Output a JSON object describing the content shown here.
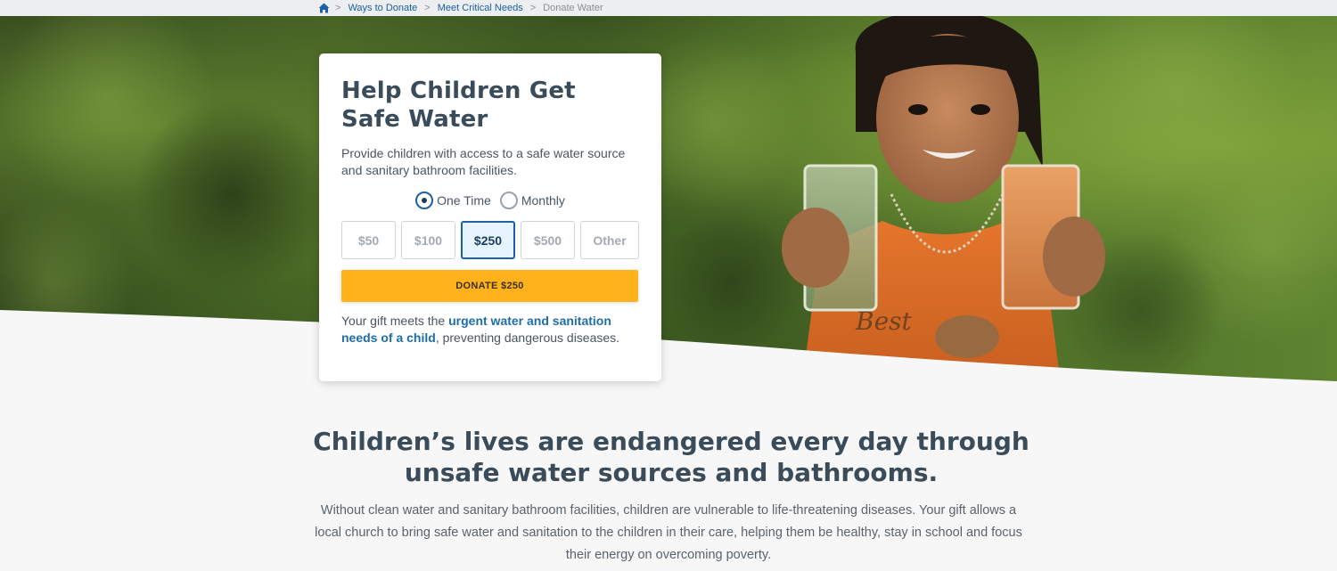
{
  "breadcrumb": {
    "home_icon": "home-icon",
    "separator": ">",
    "items": [
      "Ways to Donate",
      "Meet Critical Needs"
    ],
    "current": "Donate Water"
  },
  "card": {
    "title": "Help Children Get Safe Water",
    "description": "Provide children with access to a safe water source and sanitary bathroom facilities.",
    "frequency": {
      "options": [
        "One Time",
        "Monthly"
      ],
      "selected": "One Time"
    },
    "amounts": [
      "$50",
      "$100",
      "$250",
      "$500",
      "Other"
    ],
    "selected_amount": "$250",
    "donate_label": "DONATE $250",
    "gift_text_prefix": "Your gift meets the ",
    "gift_text_link": "urgent water and sanitation needs of a child",
    "gift_text_suffix": ", preventing dangerous diseases."
  },
  "content": {
    "headline": "Children’s lives are endangered every day through unsafe water sources and bathrooms.",
    "body": "Without clean water and sanitary bathroom facilities, children are vulnerable to life-threatening diseases. Your gift allows a local church to bring safe water and sanitation to the children in their care, helping them be healthy, stay in school and focus their energy on overcoming poverty."
  },
  "colors": {
    "accent_blue": "#1d5fa8",
    "donate_yellow": "#ffb21b",
    "heading": "#3a4b59"
  }
}
